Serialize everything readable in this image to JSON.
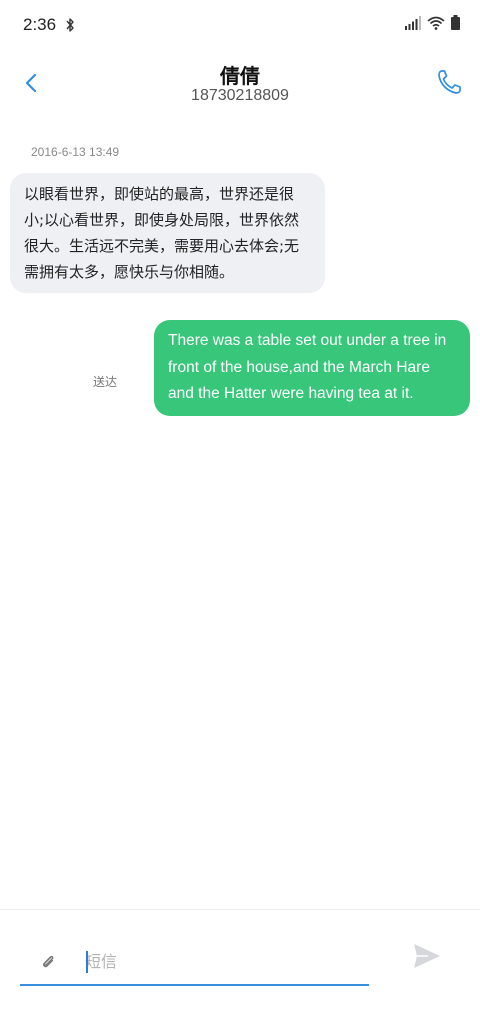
{
  "status_bar": {
    "time": "2:36"
  },
  "header": {
    "contact_name": "倩倩",
    "phone_number": "18730218809"
  },
  "conversation": {
    "timestamp": "2016-6-13 13:49",
    "incoming_message": "以眼看世界，即使站的最高，世界还是很小;以心看世界，即使身处局限，世界依然很大。生活远不完美，需要用心去体会;无需拥有太多，愿快乐与你相随。",
    "outgoing_message": "There was a table set out under a tree in front of the house,and the March Hare and the Hatter were having tea at it.",
    "outgoing_status": "送达"
  },
  "composer": {
    "placeholder": "短信"
  },
  "colors": {
    "accent": "#3b8de0",
    "outgoing_bubble": "#37c67a",
    "incoming_bubble": "#eef0f4",
    "send_icon": "#d5d7da"
  },
  "icons": {
    "status": [
      "bluetooth-icon",
      "signal-icon",
      "wifi-icon",
      "battery-icon"
    ],
    "header": [
      "back-arrow-icon",
      "phone-icon"
    ],
    "composer": [
      "paperclip-icon",
      "send-icon"
    ]
  }
}
